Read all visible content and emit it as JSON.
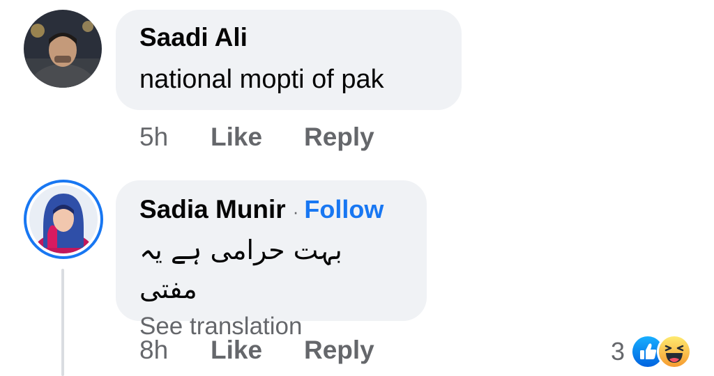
{
  "comments": [
    {
      "author": "Saadi Ali",
      "text": "national mopti of pak",
      "time": "5h",
      "like_label": "Like",
      "reply_label": "Reply"
    },
    {
      "author": "Sadia Munir",
      "separator": "·",
      "follow_label": "Follow",
      "text": "بہت حرامی ہے یہ مفتی",
      "see_translation_label": "See translation",
      "time": "8h",
      "like_label": "Like",
      "reply_label": "Reply",
      "reaction_count": "3",
      "reaction_icons": [
        "like-icon",
        "haha-icon"
      ]
    }
  ],
  "colors": {
    "accent": "#1877f2",
    "bubble": "#f0f2f5",
    "secondary_text": "#65676b",
    "primary_text": "#050505",
    "haha": "#f7b125"
  }
}
